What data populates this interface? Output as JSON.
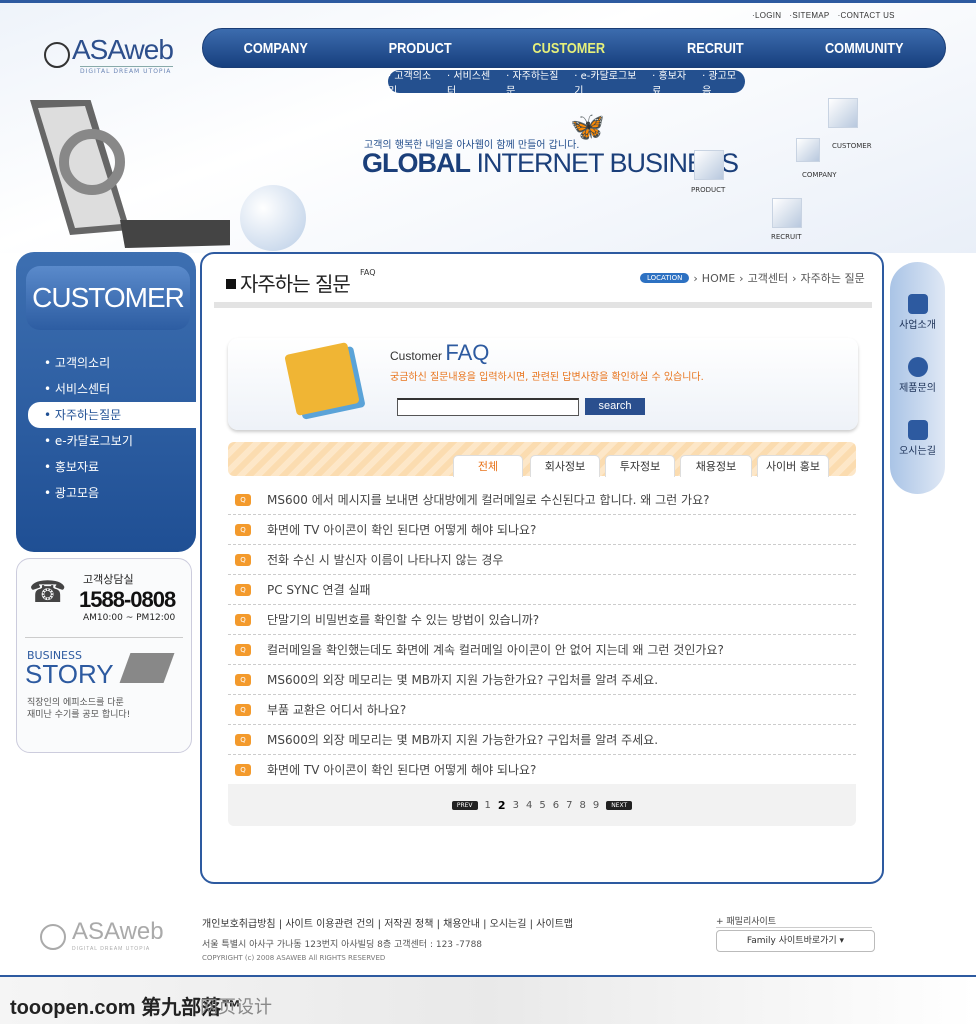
{
  "top_links": [
    "LOGIN",
    "SITEMAP",
    "CONTACT US"
  ],
  "logo": {
    "name": "ASAweb",
    "tagline": "DIGITAL DREAM UTOPIA"
  },
  "nav": [
    {
      "label": "COMPANY"
    },
    {
      "label": "PRODUCT"
    },
    {
      "label": "CUSTOMER",
      "active": true
    },
    {
      "label": "RECRUIT"
    },
    {
      "label": "COMMUNITY"
    }
  ],
  "subnav": [
    "· 고객의소리",
    "· 서비스센터",
    "· 자주하는질문",
    "· e-카달로그보기",
    "· 홍보자료",
    "· 광고모음"
  ],
  "hero": {
    "slogan": "고객의 행복한 내일을 아사웹이 함께 만들어 갑니다.",
    "title_bold": "GLOBAL",
    "title_rest": " INTERNET BUSINESS",
    "cubes": [
      "CUSTOMER",
      "COMPANY",
      "PRODUCT",
      "RECRUIT"
    ]
  },
  "sidebar": {
    "title": "CUSTOMER",
    "items": [
      {
        "label": "고객의소리"
      },
      {
        "label": "서비스센터"
      },
      {
        "label": "자주하는질문",
        "active": true
      },
      {
        "label": "e-카달로그보기"
      },
      {
        "label": "홍보자료"
      },
      {
        "label": "광고모음"
      }
    ]
  },
  "support": {
    "label": "고객상담실",
    "phone": "1588-0808",
    "hours": "AM10:00 ~ PM12:00",
    "story_small": "BUSINESS",
    "story_big": "STORY",
    "story_text1": "직장인의 에피소드를 다룬",
    "story_text2": "재미난 수기를 공모 합니다!"
  },
  "page": {
    "title": "자주하는 질문",
    "subtitle": "FAQ",
    "location_badge": "LOCATION",
    "breadcrumb": [
      "HOME",
      "고객센터",
      "자주하는 질문"
    ]
  },
  "faq_search": {
    "heading_small": "Customer",
    "heading_big": "FAQ",
    "guide": "궁금하신 질문내용을 입력하시면, 관련된 답변사항을 확인하실 수 있습니다.",
    "input_value": "",
    "button": "search"
  },
  "tabs": [
    {
      "label": "전체",
      "active": true
    },
    {
      "label": "회사정보"
    },
    {
      "label": "투자정보"
    },
    {
      "label": "채용정보"
    },
    {
      "label": "사이버 홍보"
    }
  ],
  "faq_icon": "Q",
  "faqs": [
    "MS600 에서 메시지를 보내면 상대방에게 컬러메일로 수신된다고 합니다. 왜 그런 가요?",
    "화면에 TV 아이콘이 확인 된다면 어떻게 해야 되나요?",
    "전화 수신 시 발신자 이름이 나타나지 않는 경우",
    "PC SYNC 연결 실패",
    "단말기의 비밀번호를 확인할 수 있는 방법이 있습니까?",
    "컬러메일을 확인했는데도 화면에 계속 컬러메일 아이콘이 안 없어 지는데 왜 그런 것인가요?",
    "MS600의 외장 메모리는 몇 MB까지 지원 가능한가요? 구입처를 알려 주세요.",
    "부품 교환은 어디서 하나요?",
    "MS600의 외장 메모리는 몇 MB까지 지원 가능한가요? 구입처를 알려 주세요.",
    "화면에 TV 아이콘이 확인 된다면 어떻게 해야 되나요?"
  ],
  "pagination": {
    "prev": "PREV",
    "next": "NEXT",
    "pages": [
      "1",
      "2",
      "3",
      "4",
      "5",
      "6",
      "7",
      "8",
      "9"
    ],
    "current": "2"
  },
  "quick_menu": [
    {
      "label": "사업소개",
      "icon": "document-icon"
    },
    {
      "label": "제품문의",
      "icon": "phone-icon"
    },
    {
      "label": "오시는길",
      "icon": "house-icon"
    }
  ],
  "footer": {
    "links": "개인보호취급방침 | 사이트 이용관련 건의 | 저작권 정책 | 채용안내 | 오시는길 | 사이트맵",
    "address": "서울 특별시 아사구 가나동 123번지 아사빌딩 8층  고객센터 : 123 -7788",
    "copyright": "COPYRIGHT (c) 2008 ASAWEB All RIGHTS RESERVED",
    "family_label": "패밀리사이트",
    "family_select": "Family 사이트바로가기  ▾"
  },
  "watermark": {
    "brand": "tooopen.com 第九部落™",
    "section": "网页设计"
  },
  "colors": {
    "primary": "#2d5aa0",
    "accent": "#e8741c",
    "nav_active": "#e6f07a"
  }
}
